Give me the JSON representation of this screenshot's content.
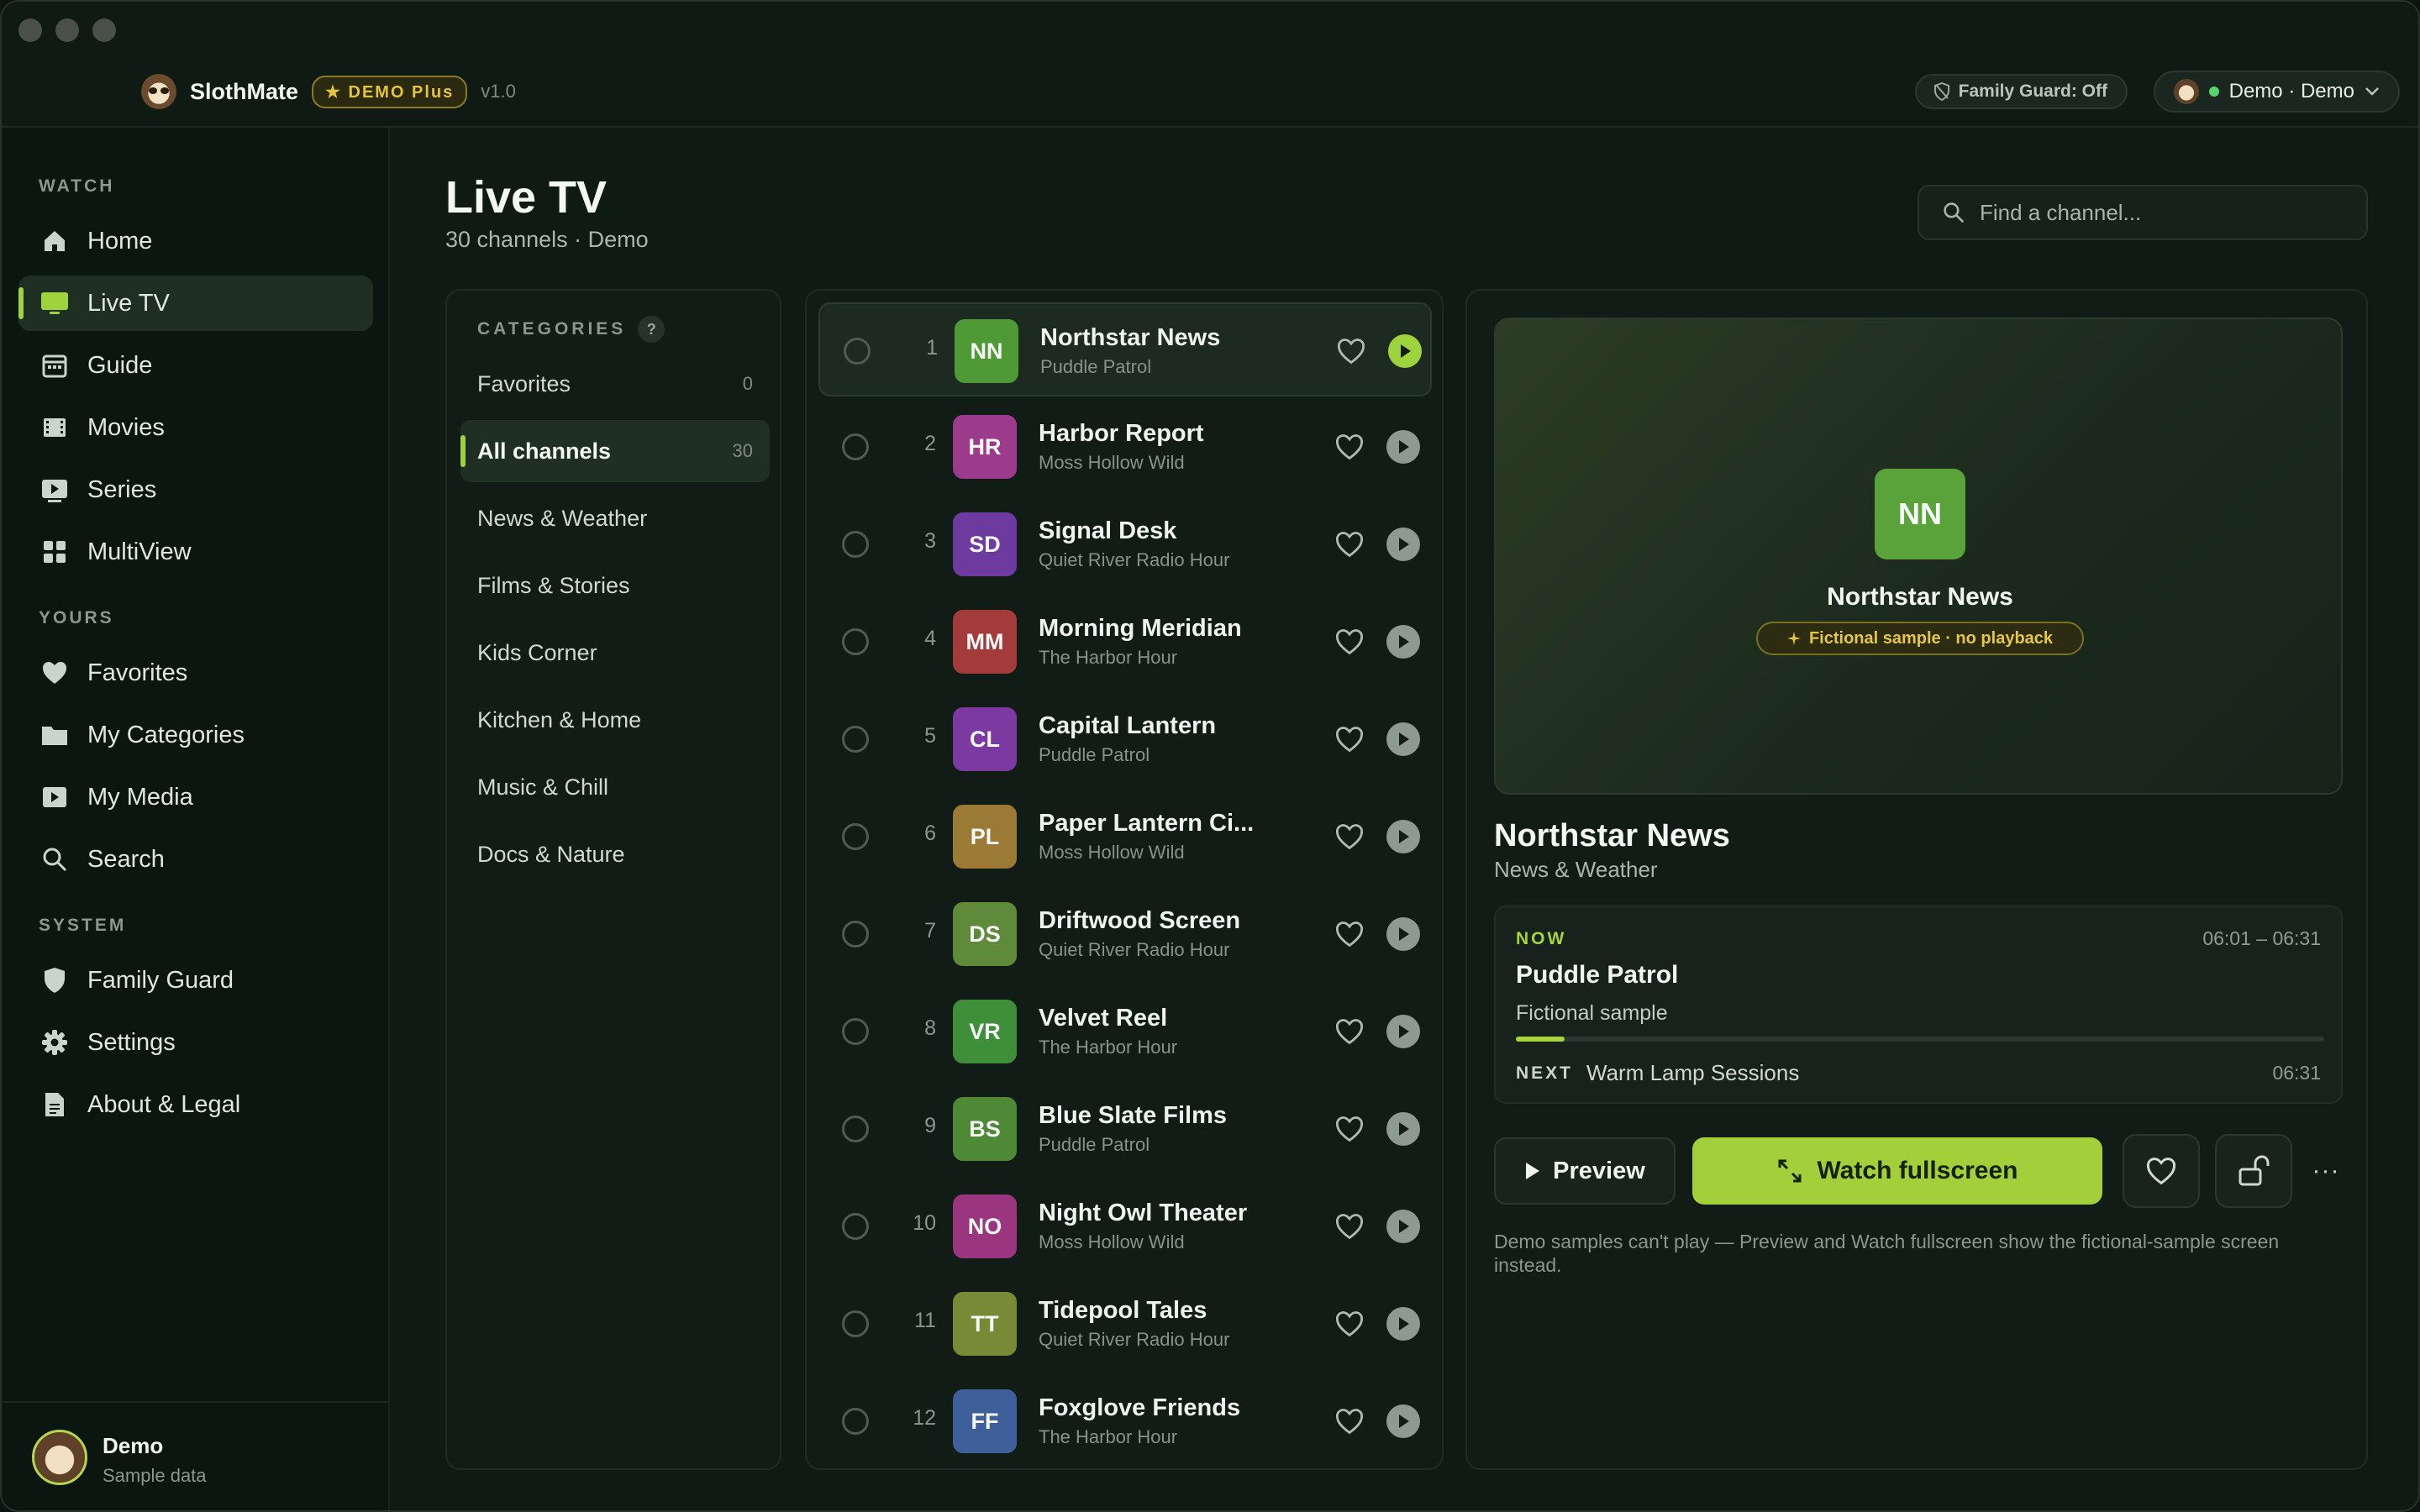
{
  "app": {
    "name": "SlothMate",
    "badge": "★ DEMO Plus",
    "version": "v1.0",
    "family_guard_pill": "Family Guard: Off",
    "user_pill": "Demo · Demo"
  },
  "sidebar": {
    "sections": {
      "watch": "WATCH",
      "yours": "YOURS",
      "system": "SYSTEM"
    },
    "items": [
      {
        "label": "Home",
        "icon": "home-icon"
      },
      {
        "label": "Live TV",
        "icon": "tv-icon",
        "active": true
      },
      {
        "label": "Guide",
        "icon": "calendar-icon"
      },
      {
        "label": "Movies",
        "icon": "film-icon"
      },
      {
        "label": "Series",
        "icon": "play-square-icon"
      },
      {
        "label": "MultiView",
        "icon": "grid-icon"
      },
      {
        "label": "Favorites",
        "icon": "heart-icon"
      },
      {
        "label": "My Categories",
        "icon": "folder-icon"
      },
      {
        "label": "My Media",
        "icon": "media-icon"
      },
      {
        "label": "Search",
        "icon": "search-icon"
      },
      {
        "label": "Family Guard",
        "icon": "shield-icon"
      },
      {
        "label": "Settings",
        "icon": "gear-icon"
      },
      {
        "label": "About & Legal",
        "icon": "document-icon"
      }
    ],
    "footer": {
      "name": "Demo",
      "sub": "Sample data"
    }
  },
  "header": {
    "title": "Live TV",
    "subtitle": "30 channels · Demo",
    "search_placeholder": "Find a channel..."
  },
  "categories": {
    "heading": "CATEGORIES",
    "help": "?",
    "items": [
      {
        "label": "Favorites",
        "count": "0"
      },
      {
        "label": "All channels",
        "count": "30",
        "active": true
      },
      {
        "label": "News & Weather",
        "count": ""
      },
      {
        "label": "Films & Stories",
        "count": ""
      },
      {
        "label": "Kids Corner",
        "count": ""
      },
      {
        "label": "Kitchen & Home",
        "count": ""
      },
      {
        "label": "Music & Chill",
        "count": ""
      },
      {
        "label": "Docs & Nature",
        "count": ""
      }
    ]
  },
  "channels": [
    {
      "num": "1",
      "code": "NN",
      "name": "Northstar News",
      "show": "Puddle Patrol",
      "color": "#4f9a36",
      "active": true
    },
    {
      "num": "2",
      "code": "HR",
      "name": "Harbor Report",
      "show": "Moss Hollow Wild",
      "color": "#9c3b8c"
    },
    {
      "num": "3",
      "code": "SD",
      "name": "Signal Desk",
      "show": "Quiet River Radio Hour",
      "color": "#6d3aa0"
    },
    {
      "num": "4",
      "code": "MM",
      "name": "Morning Meridian",
      "show": "The Harbor Hour",
      "color": "#a33b3b"
    },
    {
      "num": "5",
      "code": "CL",
      "name": "Capital Lantern",
      "show": "Puddle Patrol",
      "color": "#7a3aa2"
    },
    {
      "num": "6",
      "code": "PL",
      "name": "Paper Lantern Ci...",
      "show": "Moss Hollow Wild",
      "color": "#9a7a35"
    },
    {
      "num": "7",
      "code": "DS",
      "name": "Driftwood Screen",
      "show": "Quiet River Radio Hour",
      "color": "#5e8a3a"
    },
    {
      "num": "8",
      "code": "VR",
      "name": "Velvet Reel",
      "show": "The Harbor Hour",
      "color": "#3f8f3a"
    },
    {
      "num": "9",
      "code": "BS",
      "name": "Blue Slate Films",
      "show": "Puddle Patrol",
      "color": "#4e8a36"
    },
    {
      "num": "10",
      "code": "NO",
      "name": "Night Owl Theater",
      "show": "Moss Hollow Wild",
      "color": "#9b357f"
    },
    {
      "num": "11",
      "code": "TT",
      "name": "Tidepool Tales",
      "show": "Quiet River Radio Hour",
      "color": "#788a36"
    },
    {
      "num": "12",
      "code": "FF",
      "name": "Foxglove Friends",
      "show": "The Harbor Hour",
      "color": "#3f5f9a"
    }
  ],
  "detail": {
    "preview_code": "NN",
    "preview_name": "Northstar News",
    "preview_badge": "Fictional sample · no playback",
    "name": "Northstar News",
    "category": "News & Weather",
    "epg": {
      "now_label": "NOW",
      "time": "06:01 – 06:31",
      "title": "Puddle Patrol",
      "desc": "Fictional sample",
      "progress": 0.06,
      "next_label": "NEXT",
      "next_title": "Warm Lamp Sessions",
      "next_time": "06:31"
    },
    "btn_preview": "Preview",
    "btn_watch": "Watch fullscreen",
    "more": "···",
    "note": "Demo samples can't play — Preview and Watch fullscreen show the fictional-sample screen instead."
  },
  "colors": {
    "accent": "#9fd33d",
    "background": "#0f1a14",
    "nn_logo": "#5aa33a"
  }
}
